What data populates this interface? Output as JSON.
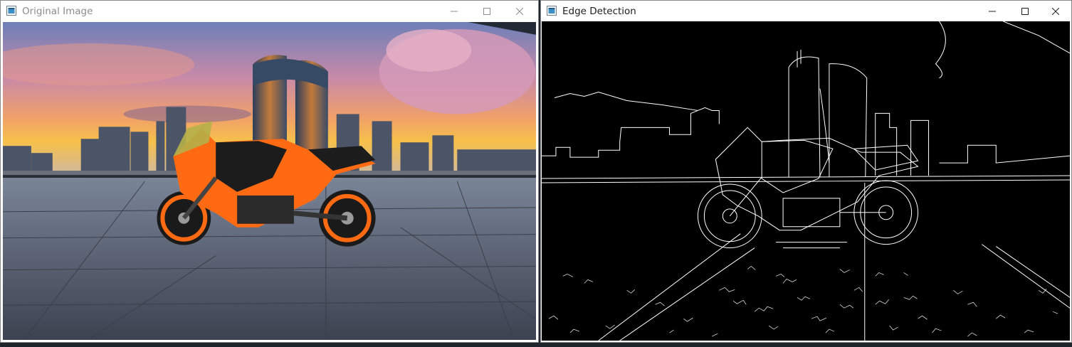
{
  "windows": {
    "original": {
      "title": "Original Image",
      "icon": "opencv-window-icon",
      "controls": [
        "minimize-icon",
        "maximize-icon",
        "close-icon"
      ]
    },
    "edges": {
      "title": "Edge Detection",
      "icon": "opencv-window-icon",
      "controls": [
        "minimize-icon",
        "maximize-icon",
        "close-icon"
      ]
    }
  },
  "colors": {
    "titlebar": "#ffffff",
    "inactive_title_text": "#8c8c8c",
    "active_title_text": "#202020",
    "edge_background": "#000000",
    "edge_lines": "#ffffff",
    "bike_orange": "#ff6a13"
  }
}
